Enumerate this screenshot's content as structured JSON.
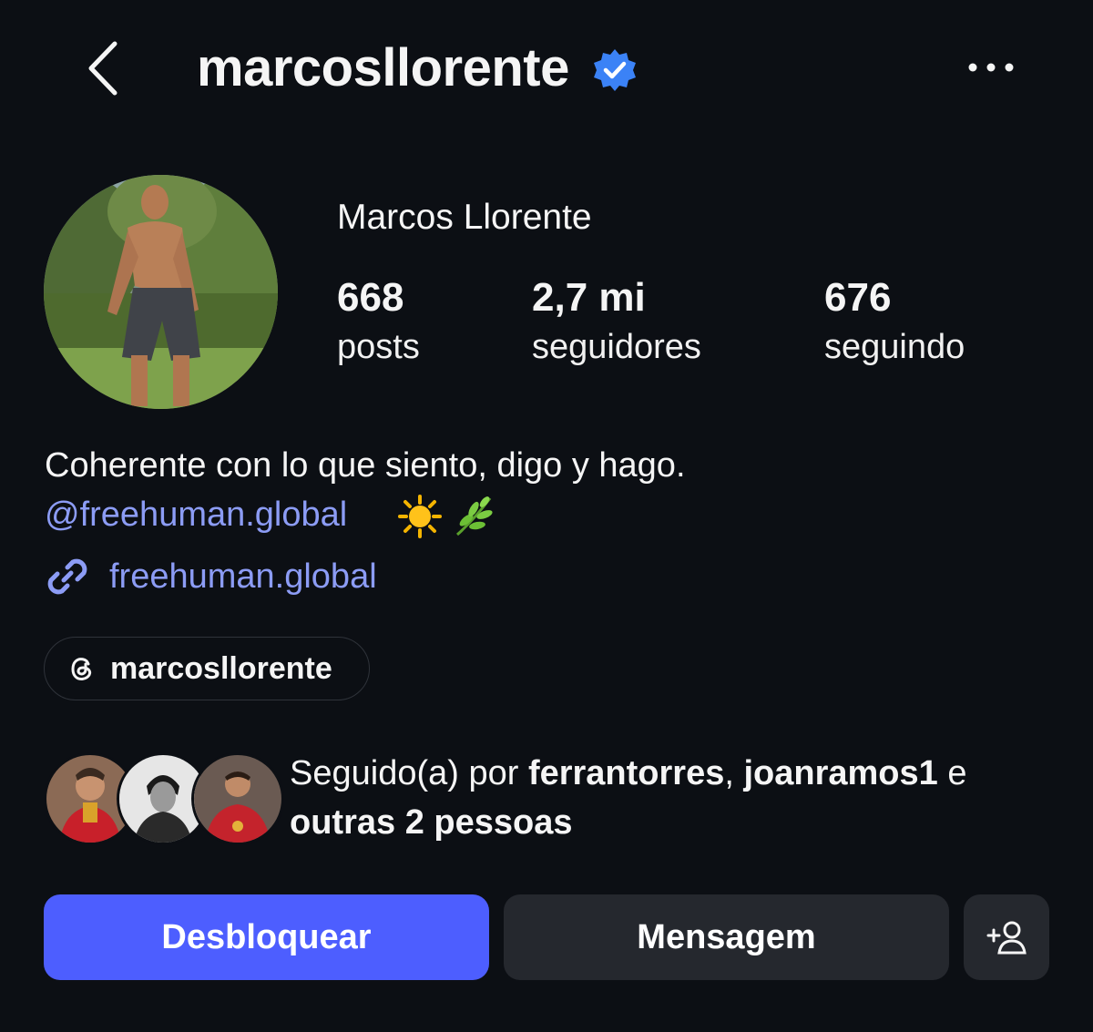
{
  "header": {
    "back_icon": "chevron-left-icon",
    "username": "marcosllorente",
    "verified_icon": "verified-badge-icon",
    "more_icon": "more-horizontal-icon"
  },
  "profile": {
    "display_name": "Marcos Llorente",
    "avatar": "profile-photo"
  },
  "stats": [
    {
      "value": "668",
      "label": "posts"
    },
    {
      "value": "2,7 mi",
      "label": "seguidores"
    },
    {
      "value": "676",
      "label": "seguindo"
    }
  ],
  "bio": {
    "line1": "Coherente con lo que siento, digo y hago.",
    "mention": "@freehuman.global",
    "emojis": [
      "sun-emoji",
      "herb-emoji"
    ],
    "link_icon": "link-icon",
    "link": "freehuman.global"
  },
  "threads": {
    "icon": "threads-icon",
    "handle": "marcosllorente"
  },
  "followed_by": {
    "prefix": "Seguido(a) por ",
    "user1": "ferrantorres",
    "sep": ", ",
    "user2": "joanramos1",
    "conj": " e",
    "others": "outras 2 pessoas"
  },
  "actions": {
    "unblock": "Desbloquear",
    "message": "Mensagem",
    "add_icon": "add-person-icon"
  },
  "colors": {
    "background": "#0c0f14",
    "accent_button": "#4d5eff",
    "link": "#8c9cf5",
    "verified": "#3b82f6",
    "secondary_button": "#25282e"
  }
}
